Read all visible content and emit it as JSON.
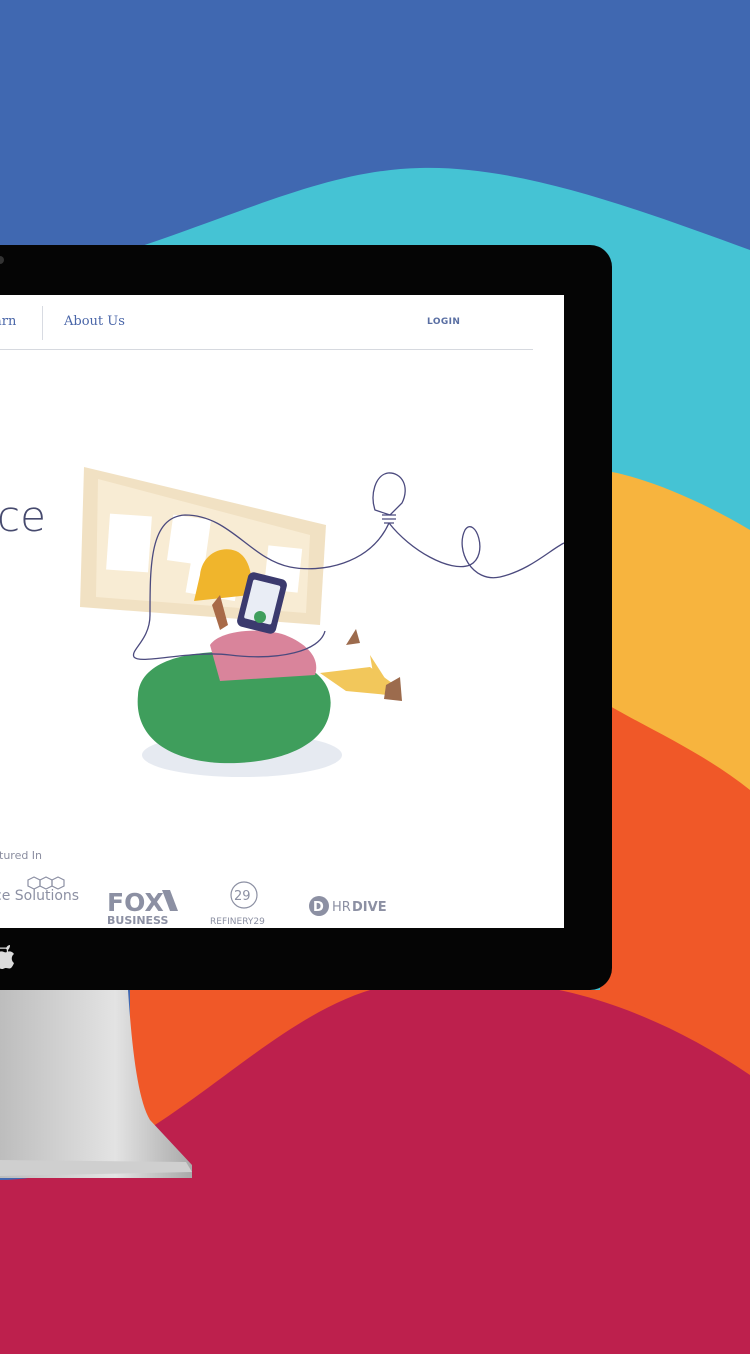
{
  "colors": {
    "background_blue": "#4068b1",
    "band_cyan": "#45c3d4",
    "band_yellow": "#f7b43e",
    "band_orange": "#f05828",
    "band_crimson": "#bd204d",
    "monitor_black": "#050505",
    "nav_link": "#4a66a8",
    "hero_text": "#464a6e",
    "beanbag_green": "#3f9e5c"
  },
  "nav": {
    "prev_item_label": "arn",
    "about_label": "About Us",
    "login_label": "LOGIN"
  },
  "hero": {
    "headline_fragment": "ce"
  },
  "featured": {
    "label": "tured In",
    "logos": {
      "salesforce_solutions": "ce Solutions",
      "fox_top": "FOX",
      "fox_bottom": "BUSINESS",
      "refinery_badge": "29",
      "refinery_label": "REFINERY29",
      "hrdive_badge": "D",
      "hrdive_label_light": "HR",
      "hrdive_label_bold": "DIVE"
    }
  },
  "icons": {
    "apple_logo": "apple-logo-icon",
    "lightbulb": "lightbulb-icon",
    "tablet": "tablet-icon"
  }
}
